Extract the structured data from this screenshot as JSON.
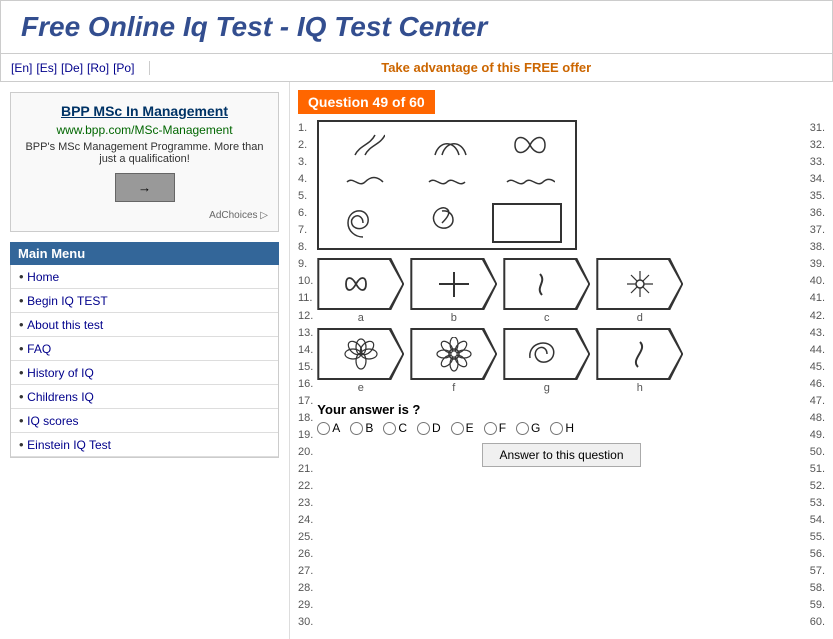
{
  "header": {
    "title": "Free Online Iq Test - IQ Test Center"
  },
  "navbar": {
    "langs": [
      "[En]",
      "[Es]",
      "[De]",
      "[Ro]",
      "[Po]"
    ],
    "offer": "Take advantage of this FREE offer"
  },
  "ad": {
    "title": "BPP MSc In Management",
    "url": "www.bpp.com/MSc-Management",
    "desc": "BPP's MSc Management Programme. More than just a qualification!",
    "arrow": "→",
    "adchoices": "AdChoices ▷"
  },
  "menu": {
    "header": "Main Menu",
    "items": [
      {
        "label": "Home",
        "href": "#"
      },
      {
        "label": "Begin IQ TEST",
        "href": "#"
      },
      {
        "label": "About this test",
        "href": "#"
      },
      {
        "label": "FAQ",
        "href": "#"
      },
      {
        "label": "History of IQ",
        "href": "#"
      },
      {
        "label": "Childrens IQ",
        "href": "#"
      },
      {
        "label": "IQ scores",
        "href": "#"
      },
      {
        "label": "Einstein IQ Test",
        "href": "#"
      }
    ]
  },
  "question": {
    "header": "Question 49 of 60",
    "left_numbers": [
      "1.",
      "2.",
      "3.",
      "4.",
      "5.",
      "6.",
      "7.",
      "8.",
      "9.",
      "10.",
      "11.",
      "12.",
      "13.",
      "14.",
      "15.",
      "16.",
      "17.",
      "18.",
      "19.",
      "20.",
      "21.",
      "22.",
      "23.",
      "24.",
      "25.",
      "26.",
      "27.",
      "28.",
      "29.",
      "30."
    ],
    "right_numbers": [
      "31.",
      "32.",
      "33.",
      "34.",
      "35.",
      "36.",
      "37.",
      "38.",
      "39.",
      "40.",
      "41.",
      "42.",
      "43.",
      "44.",
      "45.",
      "46.",
      "47.",
      "48.",
      "49.",
      "50.",
      "51.",
      "52.",
      "53.",
      "54.",
      "55.",
      "56.",
      "57.",
      "58.",
      "59.",
      "60."
    ],
    "your_answer": "Your answer is ?",
    "radio_options": [
      "A",
      "B",
      "C",
      "D",
      "E",
      "F",
      "G",
      "H"
    ],
    "answer_button": "Answer to this question",
    "answer_labels": [
      "a",
      "b",
      "c",
      "d",
      "e",
      "f",
      "g",
      "h"
    ]
  }
}
